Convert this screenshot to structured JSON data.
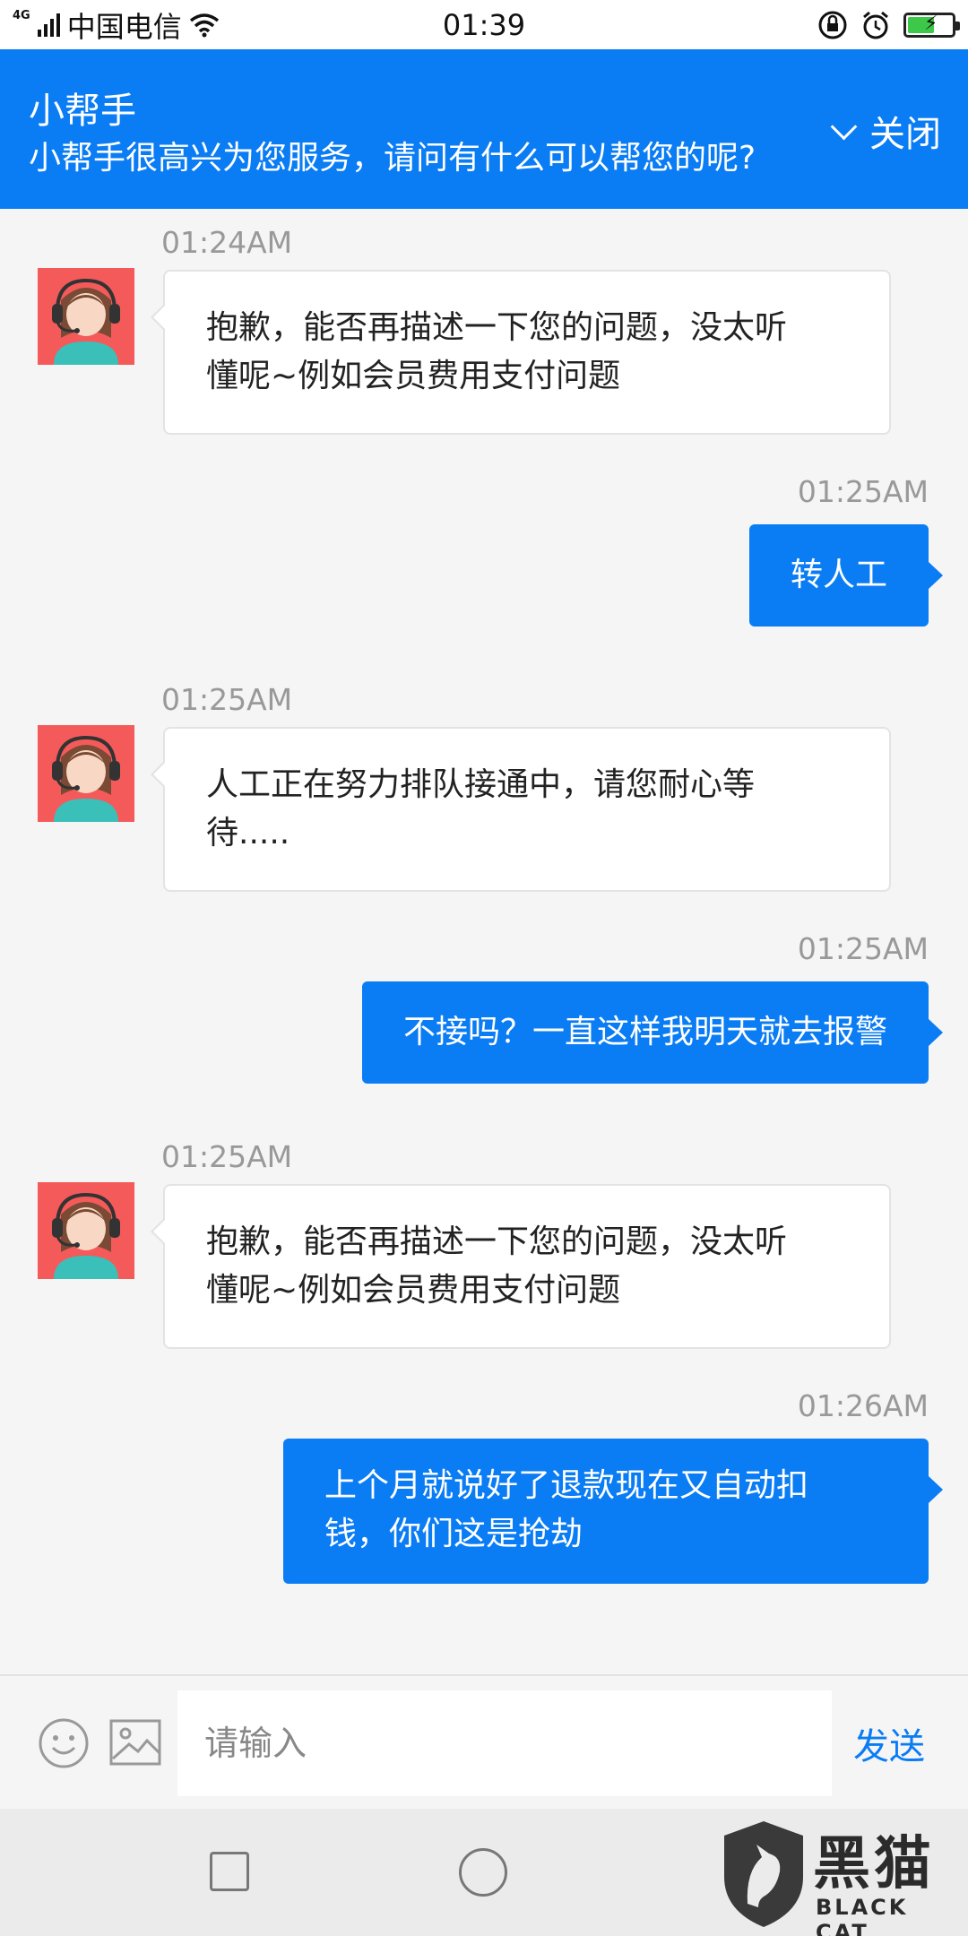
{
  "status_bar": {
    "network": "4G",
    "carrier": "中国电信",
    "time": "01:39"
  },
  "header": {
    "title": "小帮手",
    "subtitle": "小帮手很高兴为您服务，请问有什么可以帮您的呢?",
    "close_label": "关闭"
  },
  "messages": [
    {
      "sender": "agent",
      "time": "01:24AM",
      "lines": [
        "抱歉，能否再描述一下您的问题，没太听",
        "懂呢~例如会员费用支付问题"
      ]
    },
    {
      "sender": "user",
      "time": "01:25AM",
      "lines": [
        "转人工"
      ]
    },
    {
      "sender": "agent",
      "time": "01:25AM",
      "lines": [
        "人工正在努力排队接通中，请您耐心等",
        "待....."
      ]
    },
    {
      "sender": "user",
      "time": "01:25AM",
      "lines": [
        "不接吗？一直这样我明天就去报警"
      ]
    },
    {
      "sender": "agent",
      "time": "01:25AM",
      "lines": [
        "抱歉，能否再描述一下您的问题，没太听",
        "懂呢~例如会员费用支付问题"
      ]
    },
    {
      "sender": "user",
      "time": "01:26AM",
      "lines": [
        "上个月就说好了退款现在又自动扣",
        "钱，你们这是抢劫"
      ]
    }
  ],
  "input_bar": {
    "placeholder": "请输入",
    "send_label": "发送",
    "emoji_icon": "smiley-icon",
    "image_icon": "image-icon"
  },
  "watermark": {
    "cn": "黑猫",
    "en": "BLACK CAT"
  },
  "colors": {
    "accent": "#0a7cf4",
    "avatar_bg": "#f55a5a"
  }
}
